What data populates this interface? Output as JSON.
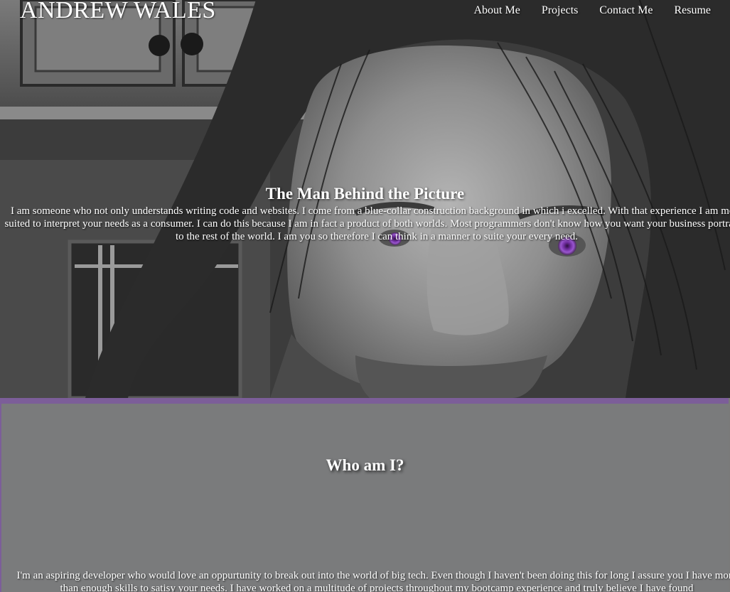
{
  "header": {
    "site_title": "ANDREW WALES",
    "nav": [
      {
        "label": "About Me"
      },
      {
        "label": "Projects"
      },
      {
        "label": "Contact Me"
      },
      {
        "label": "Resume"
      }
    ]
  },
  "hero": {
    "heading": "The Man Behind the Picture",
    "text": "I am someone who not only understands writing code and websites. I come from a blue-collar construction background in which i excelled. With that experience I am more suited to interpret your needs as a consumer. I can do this because I am in fact a product of both worlds. Most programmers don't know how you want your business portrayed to the rest of the world. I am you so therefore I can think in a manner to suite your every need."
  },
  "about": {
    "heading": "Who am I?",
    "text": "I'm an aspiring developer who would love an oppurtunity to break out into the world of big tech. Even though I haven't been doing this for long I assure you I have more than enough skills to satisy your needs. I have worked on a multitude of projects throughout my bootcamp experience and truly believe I have found"
  },
  "colors": {
    "accent_border": "#7c5e99",
    "about_background": "#7a7b7c",
    "eye_color": "#8a3fc0"
  }
}
